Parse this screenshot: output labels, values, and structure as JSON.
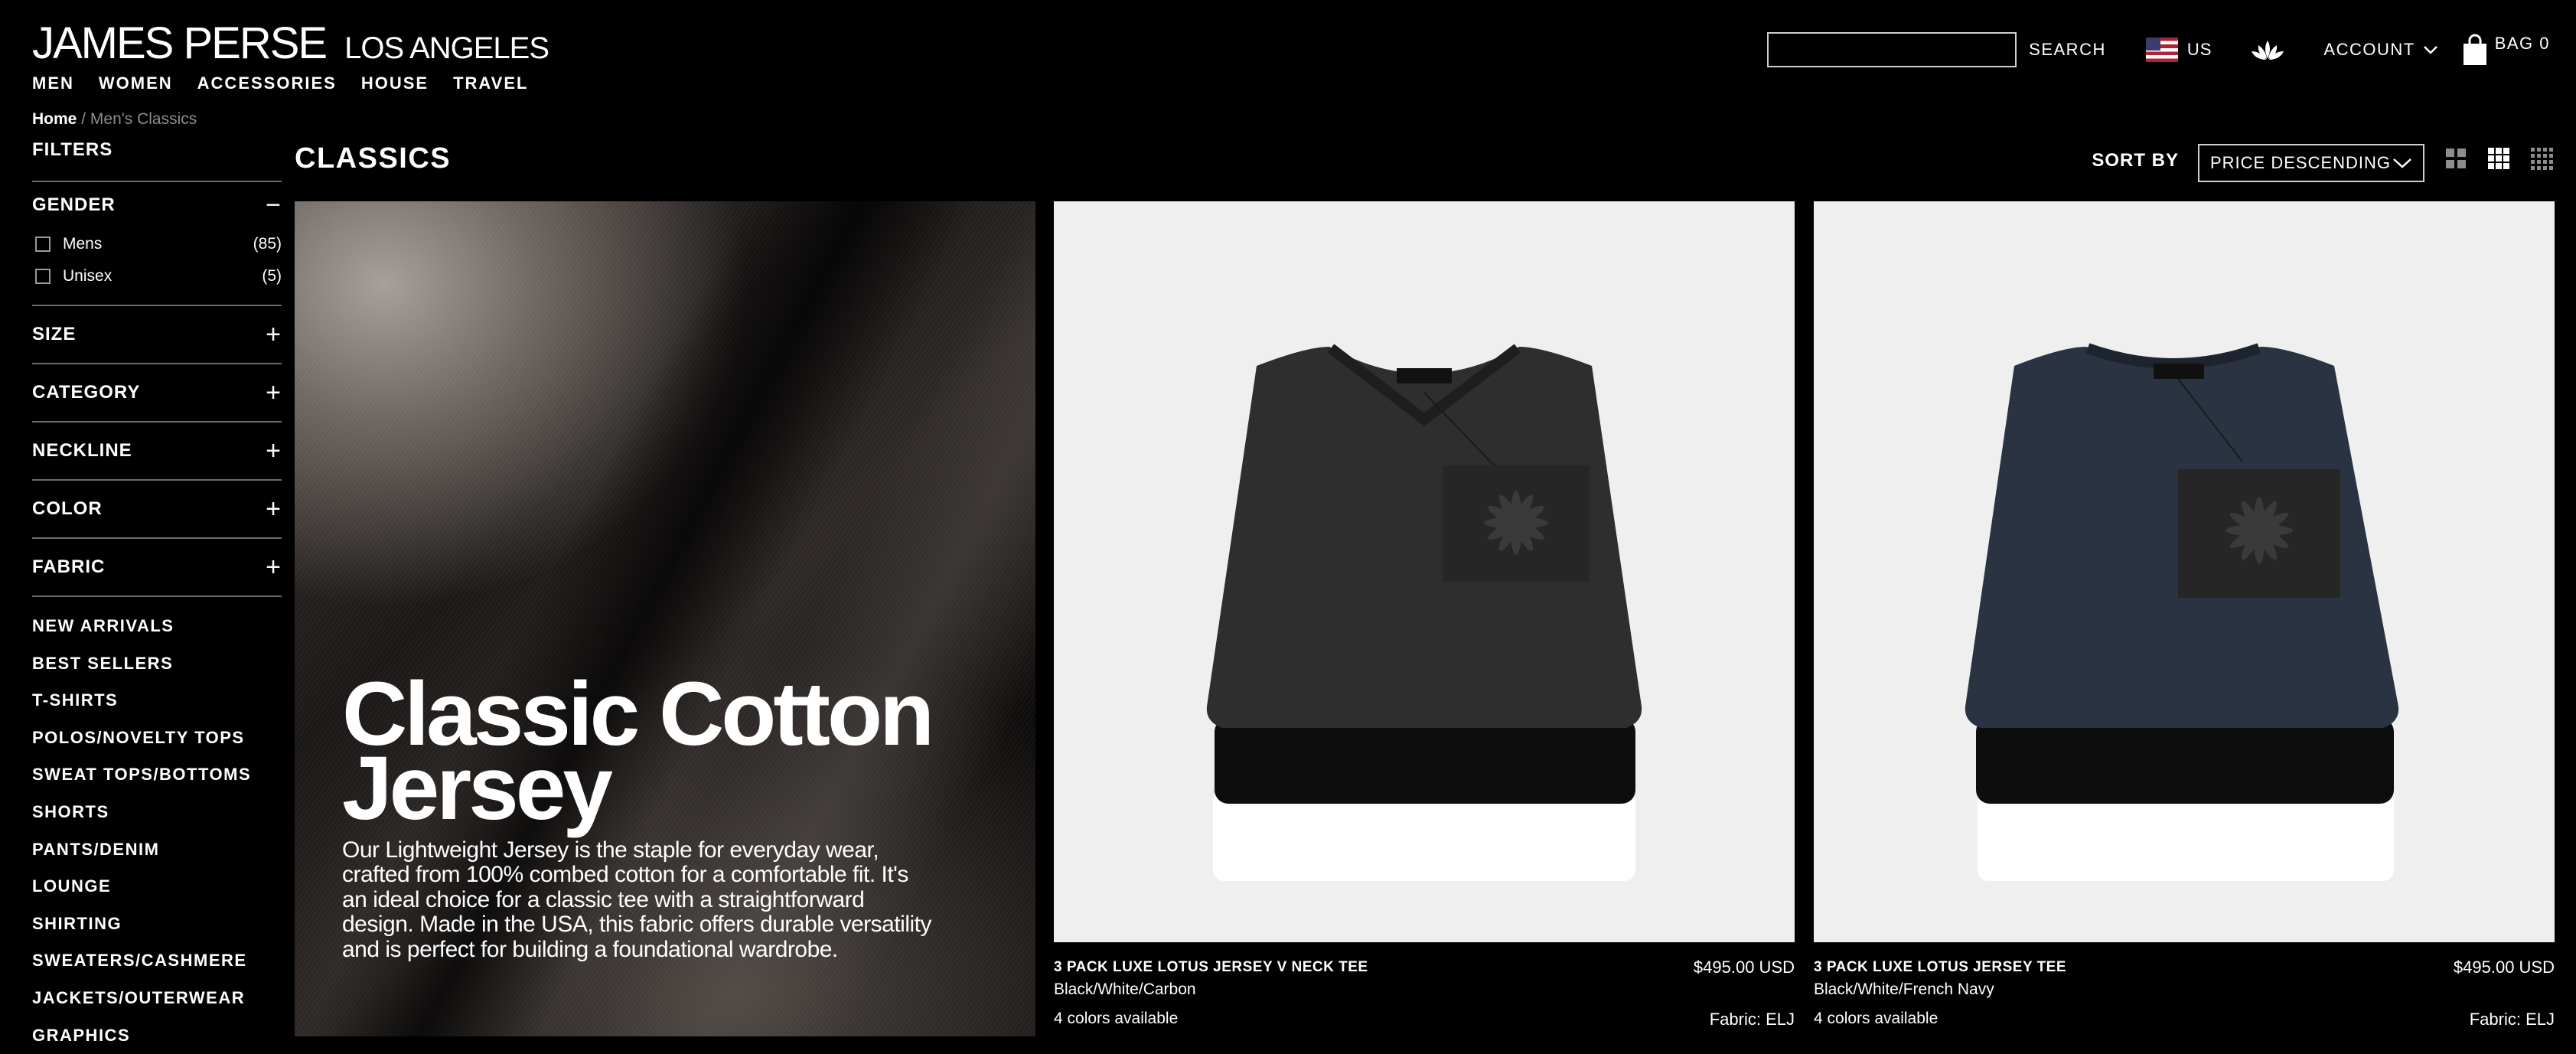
{
  "brand": {
    "name": "JAMES PERSE",
    "city": "LOS ANGELES"
  },
  "nav": [
    "MEN",
    "WOMEN",
    "ACCESSORIES",
    "HOUSE",
    "TRAVEL"
  ],
  "header": {
    "search_placeholder": "",
    "search_label": "SEARCH",
    "region": "US",
    "account_label": "ACCOUNT",
    "bag_label": "BAG 0"
  },
  "breadcrumb": {
    "home": "Home",
    "separator": "/",
    "current": "Men's Classics"
  },
  "filters": {
    "title": "FILTERS",
    "gender": {
      "label": "GENDER",
      "toggle": "−",
      "options": [
        {
          "label": "Mens",
          "count": "(85)"
        },
        {
          "label": "Unisex",
          "count": "(5)"
        }
      ]
    },
    "collapsed": [
      {
        "label": "SIZE",
        "toggle": "+"
      },
      {
        "label": "CATEGORY",
        "toggle": "+"
      },
      {
        "label": "NECKLINE",
        "toggle": "+"
      },
      {
        "label": "COLOR",
        "toggle": "+"
      },
      {
        "label": "FABRIC",
        "toggle": "+"
      }
    ]
  },
  "categories": [
    "NEW ARRIVALS",
    "BEST SELLERS",
    "T-SHIRTS",
    "POLOS/NOVELTY TOPS",
    "SWEAT TOPS/BOTTOMS",
    "SHORTS",
    "PANTS/DENIM",
    "LOUNGE",
    "SHIRTING",
    "SWEATERS/CASHMERE",
    "JACKETS/OUTERWEAR",
    "GRAPHICS"
  ],
  "page": {
    "title": "CLASSICS"
  },
  "sort": {
    "label": "SORT BY",
    "value": "PRICE DESCENDING"
  },
  "hero": {
    "title": "Classic Cotton Jersey",
    "text": "Our Lightweight Jersey is the staple for everyday wear, crafted from 100% combed cotton for a comfortable fit. It's an ideal choice for a classic tee with a straightforward design. Made in the USA, this fabric offers durable versatility and is perfect for building a foundational wardrobe."
  },
  "products": [
    {
      "name": "3 PACK LUXE LOTUS JERSEY V NECK TEE",
      "price": "$495.00 USD",
      "color": "Black/White/Carbon",
      "availability": "4 colors available",
      "fabric": "Fabric: ELJ",
      "top_color": "#2e2e2e",
      "neck": "v-neck"
    },
    {
      "name": "3 PACK LUXE LOTUS JERSEY TEE",
      "price": "$495.00 USD",
      "color": "Black/White/French Navy",
      "availability": "4 colors available",
      "fabric": "Fabric: ELJ",
      "top_color": "#2a3342",
      "neck": "crew"
    }
  ],
  "colors": {
    "background": "#000000",
    "text": "#ffffff",
    "product_bg": "#efefef",
    "muted": "#8d8d8d"
  }
}
